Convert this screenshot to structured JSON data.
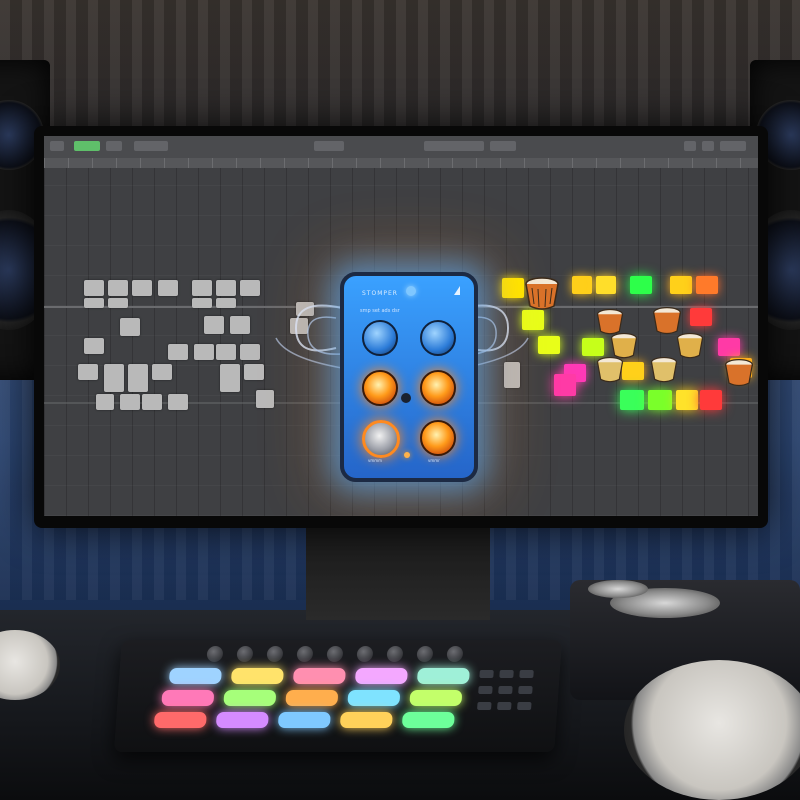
{
  "scene": {
    "type": "music production studio",
    "monitor": {
      "app": "DAW piano roll",
      "accent_colors": {
        "toolbar_button": "#5fbf6a",
        "grid": "#3f4043"
      }
    },
    "effect_pedal": {
      "title": "STOMPER",
      "subtitle": "smp set ads dsr",
      "knobs": [
        {
          "color": "blue",
          "icon": "knob-icon"
        },
        {
          "color": "blue",
          "icon": "knob-icon"
        },
        {
          "color": "orange",
          "icon": "knob-icon"
        },
        {
          "color": "orange",
          "icon": "knob-icon"
        },
        {
          "color": "steel",
          "icon": "footswitch-icon"
        },
        {
          "color": "orange",
          "icon": "footswitch-icon"
        }
      ],
      "foot_labels": [
        "vmmm",
        "vmmr"
      ]
    },
    "pad_colors": [
      "#9fd3ff",
      "#ffe36b",
      "#ff8fb0",
      "#f4a8ff",
      "#9ff0d8",
      "#ff79b8",
      "#a6ff7a",
      "#ffae4d",
      "#7fe3ff",
      "#c3ff6a",
      "#ff6a6a",
      "#d58bff",
      "#7fc9ff",
      "#ffd15a",
      "#6dff9a"
    ]
  }
}
